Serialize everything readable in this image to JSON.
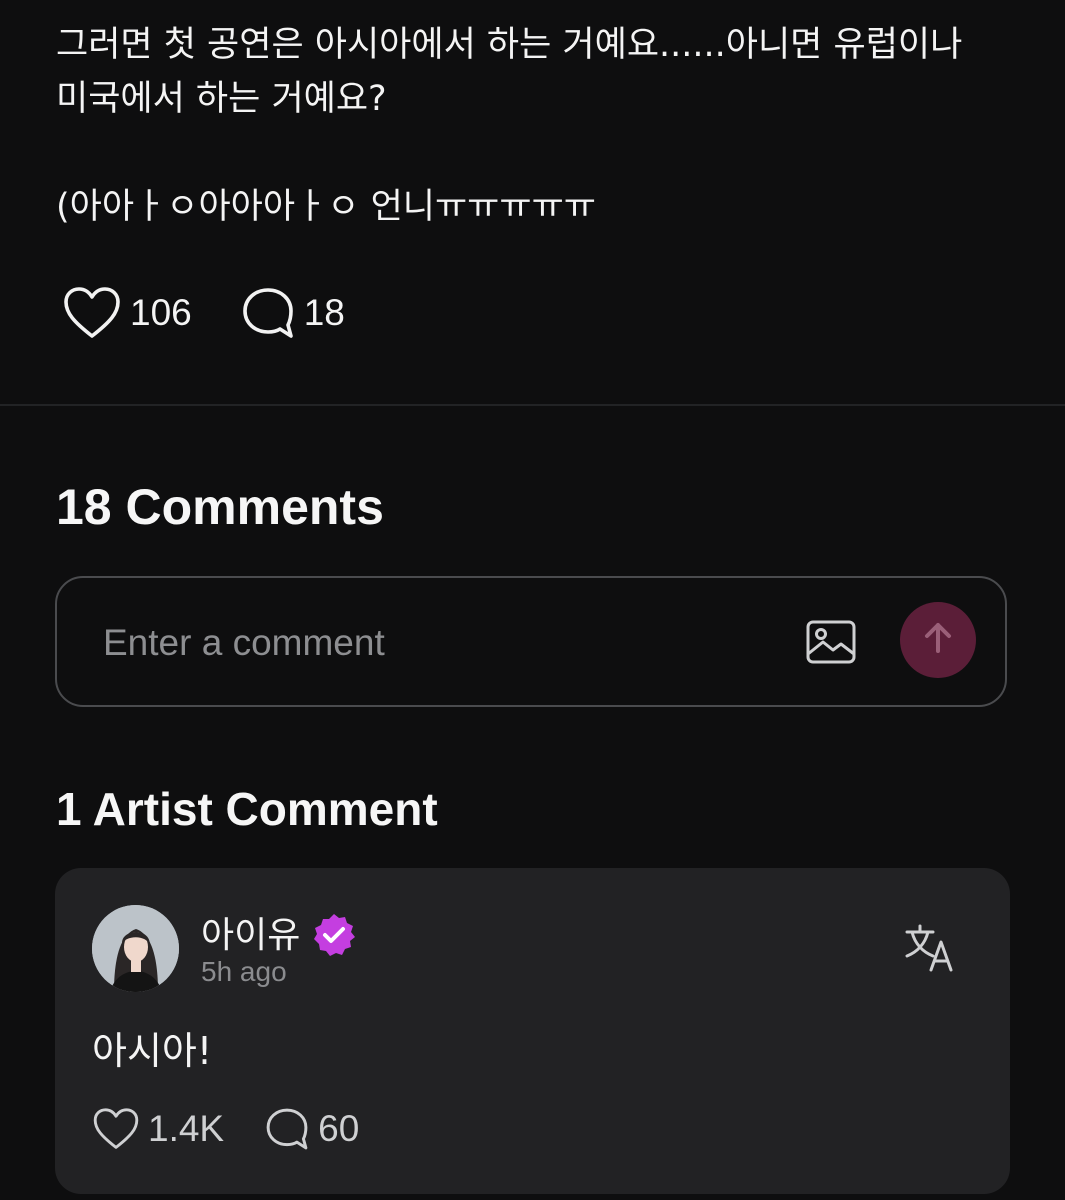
{
  "post": {
    "lines": "그러면 첫 공연은 아시아에서 하는 거예요......아니면 유럽이나\n미국에서 하는 거예요?\n\n(아아ㅏㅇ아아아ㅏㅇ 언니ㅠㅠㅠㅠㅠ",
    "likes": "106",
    "comments": "18"
  },
  "comments_section": {
    "title": "18 Comments",
    "input_placeholder": "Enter a comment"
  },
  "artist_section": {
    "title": "1 Artist Comment",
    "comment": {
      "author": "아이유",
      "timestamp": "5h ago",
      "text": "아시아!",
      "likes": "1.4K",
      "replies": "60"
    }
  },
  "icons": {
    "like": "heart-icon",
    "comment": "speech-bubble-icon",
    "image": "image-icon",
    "send": "arrow-up-icon",
    "verified": "verified-badge-icon",
    "translate": "translate-icon"
  },
  "colors": {
    "background": "#0e0e0f",
    "card": "#222224",
    "send_button": "#5b1e38",
    "verified": "#c43ee0"
  }
}
